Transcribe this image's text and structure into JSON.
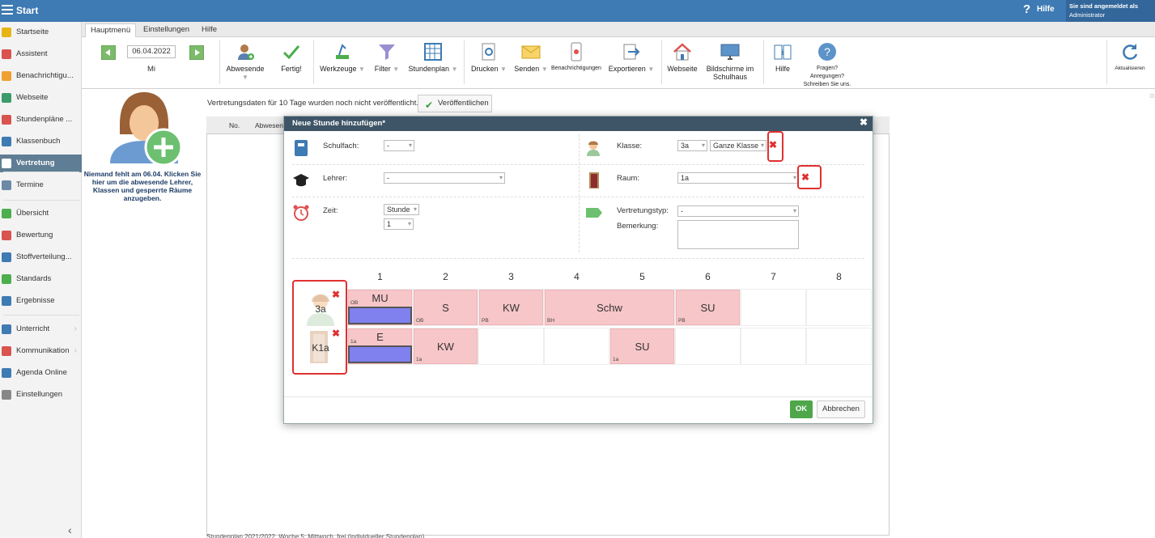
{
  "app": {
    "title": "Start",
    "help": "Hilfe",
    "login_label": "Sie sind angemeldet als",
    "login_user": "Administrator"
  },
  "sidebar": {
    "items": [
      {
        "label": "Startseite",
        "icon": "star-icon",
        "color": "#e7b416"
      },
      {
        "label": "Assistent",
        "icon": "wand-icon",
        "color": "#d9534f"
      },
      {
        "label": "Benachrichtigu...",
        "icon": "envelope-icon",
        "color": "#f0a030"
      },
      {
        "label": "Webseite",
        "icon": "house-icon",
        "color": "#3a9c6a"
      },
      {
        "label": "Stundenpläne ...",
        "icon": "timetable-icon",
        "color": "#d9534f"
      },
      {
        "label": "Klassenbuch",
        "icon": "book-icon",
        "color": "#3e7ab3"
      },
      {
        "label": "Vertretung",
        "icon": "person-icon",
        "color": "#ffffff"
      },
      {
        "label": "Termine",
        "icon": "calendar-icon",
        "color": "#6b8aa6"
      },
      {
        "label": "Übersicht",
        "icon": "check-circle-icon",
        "color": "#4cae4c"
      },
      {
        "label": "Bewertung",
        "icon": "grade-icon",
        "color": "#d9534f"
      },
      {
        "label": "Stoffverteilung...",
        "icon": "list-icon",
        "color": "#3e7ab3"
      },
      {
        "label": "Standards",
        "icon": "shield-icon",
        "color": "#4cae4c"
      },
      {
        "label": "Ergebnisse",
        "icon": "chart-icon",
        "color": "#3e7ab3"
      },
      {
        "label": "Unterricht",
        "icon": "classroom-icon",
        "color": "#3e7ab3"
      },
      {
        "label": "Kommunikation",
        "icon": "chat-icon",
        "color": "#d9534f"
      },
      {
        "label": "Agenda Online",
        "icon": "pen-icon",
        "color": "#3e7ab3"
      },
      {
        "label": "Einstellungen",
        "icon": "gear-icon",
        "color": "#888888"
      }
    ]
  },
  "tabs": [
    "Hauptmenü",
    "Einstellungen",
    "Hilfe"
  ],
  "ribbon": {
    "date": "06.04.2022",
    "day": "Mi",
    "buttons": {
      "abwesende": "Abwesende",
      "fertig": "Fertig!",
      "werkzeuge": "Werkzeuge",
      "filter": "Filter",
      "stundenplan": "Stundenplan",
      "drucken": "Drucken",
      "senden": "Senden",
      "benachrichtigungen": "Benachrichtigungen",
      "exportieren": "Exportieren",
      "webseite": "Webseite",
      "bildschirme": "Bildschirme im Schulhaus",
      "hilfe": "Hilfe",
      "fragen": "Fragen? Anregungen? Schreiben Sie uns.",
      "aktualisieren": "Aktualisieren"
    }
  },
  "absent": {
    "message": "Niemand fehlt am 06.04. Klicken Sie hier um die abwesende Lehrer, Klassen und gesperrte Räume anzugeben."
  },
  "publish": {
    "notice": "Vertretungsdaten für 10 Tage wurden noch nicht veröffentlicht.",
    "button": "Veröffentlichen"
  },
  "grid": {
    "col_no": "No.",
    "col_abwesend": "Abwesen"
  },
  "footer": {
    "text": "Stundenplan 2021/2022, Woche 5: Mittwoch, frei (individueller Stundenplan)"
  },
  "dialog": {
    "title": "Neue Stunde hinzufügen*",
    "schulfach_label": "Schulfach:",
    "schulfach_value": "-",
    "lehrer_label": "Lehrer:",
    "lehrer_value": "-",
    "zeit_label": "Zeit:",
    "zeit_unit": "Stunde",
    "zeit_value": "1",
    "klasse_label": "Klasse:",
    "klasse_value": "3a",
    "klasse_scope": "Ganze Klasse",
    "raum_label": "Raum:",
    "raum_value": "1a",
    "vtyp_label": "Vertretungstyp:",
    "vtyp_value": "-",
    "bemerkung_label": "Bemerkung:",
    "ok": "OK",
    "cancel": "Abbrechen"
  },
  "timetable": {
    "periods": [
      "1",
      "2",
      "3",
      "4",
      "5",
      "6",
      "7",
      "8"
    ],
    "rows": [
      {
        "label": "3a",
        "lessons": [
          {
            "subject": "MU",
            "tag": "OB",
            "span": 1
          },
          {
            "subject": "S",
            "tag": "OB",
            "span": 1
          },
          {
            "subject": "KW",
            "tag": "PB",
            "span": 1
          },
          {
            "subject": "Schw",
            "tag": "BH",
            "span": 2
          },
          {
            "subject": "SU",
            "tag": "PB",
            "span": 1
          }
        ]
      },
      {
        "label": "K1a",
        "lessons": [
          {
            "subject": "E",
            "tag": "1a",
            "span": 1
          },
          {
            "subject": "KW",
            "tag": "1a",
            "span": 1
          },
          {
            "subject": "SU",
            "tag": "1a",
            "span": 1
          }
        ]
      }
    ]
  }
}
